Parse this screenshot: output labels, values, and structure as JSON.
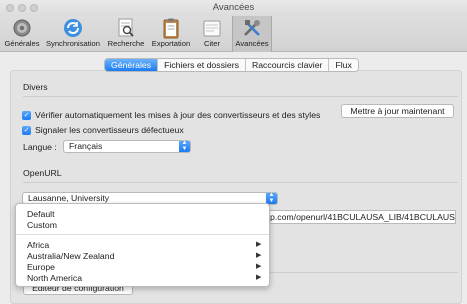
{
  "window": {
    "title": "Avancées"
  },
  "toolbar": {
    "items": [
      {
        "label": "Générales",
        "icon": "gear-icon"
      },
      {
        "label": "Synchronisation",
        "icon": "sync-icon"
      },
      {
        "label": "Recherche",
        "icon": "search-icon"
      },
      {
        "label": "Exportation",
        "icon": "clipboard-icon"
      },
      {
        "label": "Citer",
        "icon": "cite-icon"
      },
      {
        "label": "Avancées",
        "icon": "tools-icon",
        "selected": true
      }
    ]
  },
  "tabs": [
    {
      "label": "Générales",
      "active": true
    },
    {
      "label": "Fichiers et dossiers"
    },
    {
      "label": "Raccourcis clavier"
    },
    {
      "label": "Flux"
    }
  ],
  "divers": {
    "title": "Divers",
    "check_updates_label": "Vérifier automatiquement les mises à jour des convertisseurs et des styles",
    "update_now_label": "Mettre à jour maintenant",
    "report_broken_label": "Signaler les convertisseurs défectueux",
    "language_label": "Langue :",
    "language_value": "Français"
  },
  "openurl": {
    "title": "OpenURL",
    "resolver_value": "Lausanne, University",
    "url_value": "p.com/openurl/41BCULAUSA_LIB/41BCULAUS"
  },
  "config_button_label": "Éditeur de configuration",
  "dropdown_menu": {
    "items": [
      "Default",
      "Custom"
    ],
    "regions": [
      "Africa",
      "Australia/New Zealand",
      "Europe",
      "North America"
    ],
    "submenu_glyph": "▶"
  },
  "colors": {
    "accent": "#1b7cf2",
    "window_bg": "#ececec"
  }
}
